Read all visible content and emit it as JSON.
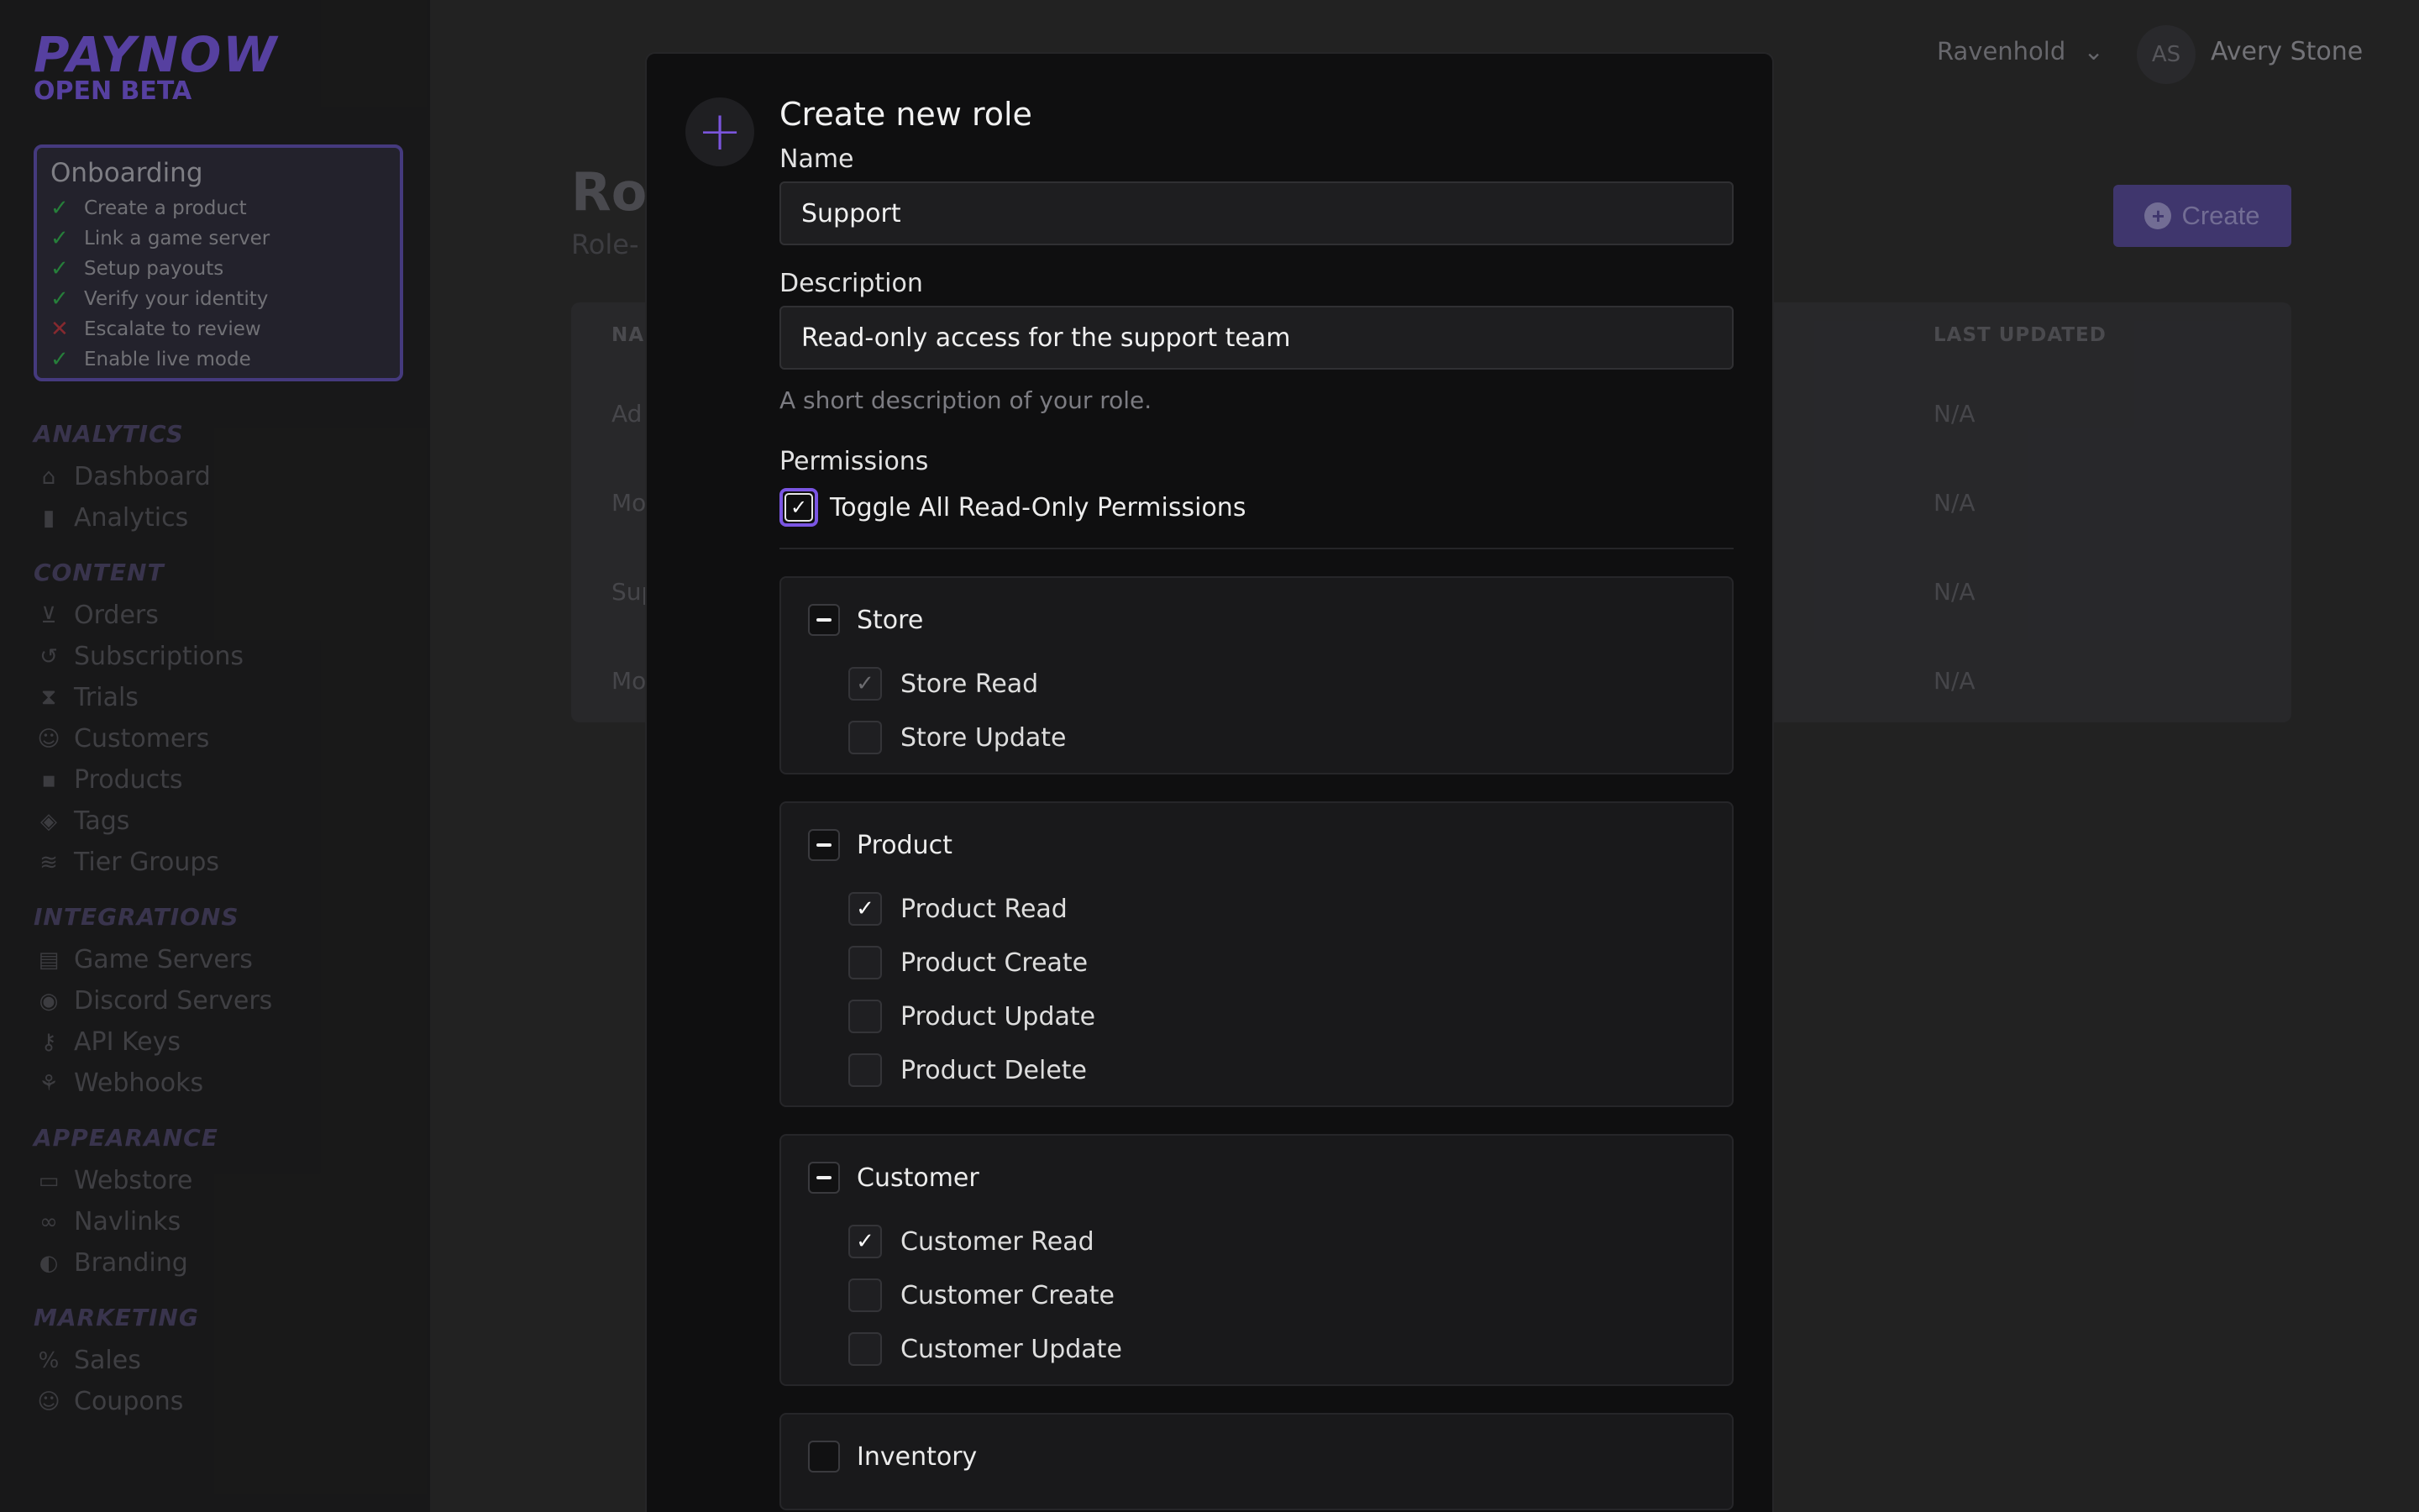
{
  "brand": {
    "name": "PAYNOW",
    "tagline": "OPEN BETA"
  },
  "onboarding": {
    "title": "Onboarding",
    "items": [
      {
        "label": "Create a product",
        "done": true
      },
      {
        "label": "Link a game server",
        "done": true
      },
      {
        "label": "Setup payouts",
        "done": true
      },
      {
        "label": "Verify your identity",
        "done": true
      },
      {
        "label": "Escalate to review",
        "done": false
      },
      {
        "label": "Enable live mode",
        "done": true
      }
    ]
  },
  "nav": {
    "analytics": {
      "title": "ANALYTICS",
      "items": [
        "Dashboard",
        "Analytics"
      ]
    },
    "content": {
      "title": "CONTENT",
      "items": [
        "Orders",
        "Subscriptions",
        "Trials",
        "Customers",
        "Products",
        "Tags",
        "Tier Groups"
      ]
    },
    "integrations": {
      "title": "INTEGRATIONS",
      "items": [
        "Game Servers",
        "Discord Servers",
        "API Keys",
        "Webhooks"
      ]
    },
    "appearance": {
      "title": "APPEARANCE",
      "items": [
        "Webstore",
        "Navlinks",
        "Branding"
      ]
    },
    "marketing": {
      "title": "MARKETING",
      "items": [
        "Sales",
        "Coupons"
      ]
    }
  },
  "topbar": {
    "store": "Ravenhold",
    "avatar_initials": "AS",
    "user": "Avery Stone"
  },
  "page": {
    "title": "Rol",
    "subtitle": "Role-",
    "create_label": "Create",
    "table": {
      "col_name": "NA",
      "col_updated": "LAST UPDATED",
      "rows": [
        {
          "name": "Ad",
          "updated": "N/A"
        },
        {
          "name": "Mo",
          "updated": "N/A"
        },
        {
          "name": "Sup",
          "updated": "N/A"
        },
        {
          "name": "Mo",
          "updated": "N/A"
        }
      ]
    }
  },
  "modal": {
    "title": "Create new role",
    "name_label": "Name",
    "name_value": "Support",
    "description_label": "Description",
    "description_value": "Read-only access for the support team",
    "description_hint": "A short description of your role.",
    "permissions_label": "Permissions",
    "toggle_all_label": "Toggle All Read-Only Permissions",
    "groups": [
      {
        "name": "Store",
        "state": "partial",
        "permissions": [
          {
            "label": "Store Read",
            "checked": true,
            "disabled": true
          },
          {
            "label": "Store Update",
            "checked": false
          }
        ]
      },
      {
        "name": "Product",
        "state": "partial",
        "permissions": [
          {
            "label": "Product Read",
            "checked": true
          },
          {
            "label": "Product Create",
            "checked": false
          },
          {
            "label": "Product Update",
            "checked": false
          },
          {
            "label": "Product Delete",
            "checked": false
          }
        ]
      },
      {
        "name": "Customer",
        "state": "partial",
        "permissions": [
          {
            "label": "Customer Read",
            "checked": true
          },
          {
            "label": "Customer Create",
            "checked": false
          },
          {
            "label": "Customer Update",
            "checked": false
          }
        ]
      },
      {
        "name": "Inventory",
        "state": "none",
        "permissions": []
      }
    ]
  },
  "colors": {
    "accent": "#7a55e2",
    "success": "#2f9a47",
    "danger": "#a4333a"
  }
}
